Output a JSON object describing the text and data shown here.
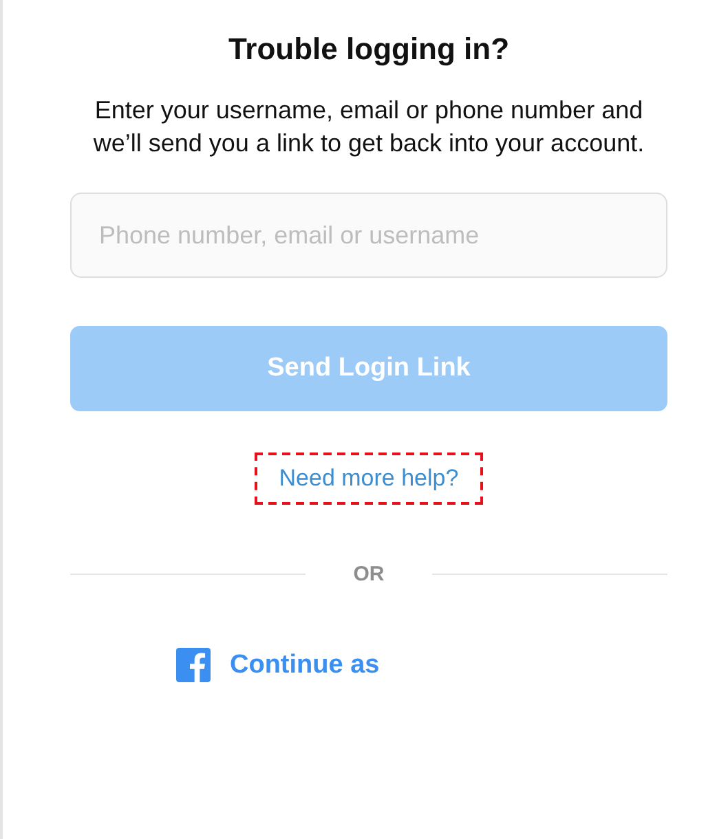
{
  "title": "Trouble logging in?",
  "description": "Enter your username, email or phone number and we’ll send you a link to get back into your account.",
  "field": {
    "placeholder": "Phone number, email or username"
  },
  "send_button": {
    "label": "Send Login Link",
    "disabled": true
  },
  "help_link": {
    "label": "Need more help?",
    "highlighted": true
  },
  "divider": {
    "label": "OR"
  },
  "continue_link": {
    "label": "Continue as"
  }
}
